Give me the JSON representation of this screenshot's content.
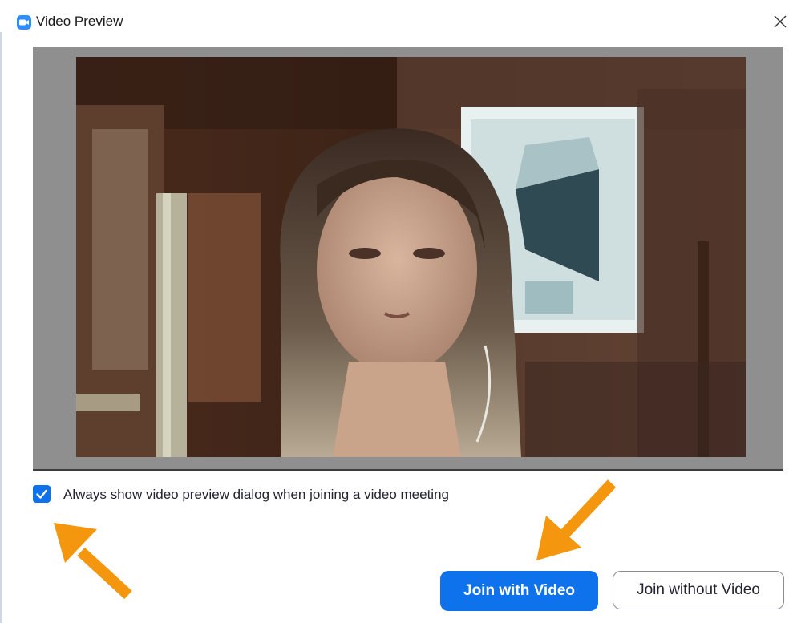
{
  "window": {
    "title": "Video Preview",
    "app_icon": "zoom-camera-icon",
    "close_icon": "close-icon"
  },
  "preview": {
    "content": "webcam-video-feed"
  },
  "options": {
    "always_show_preview": {
      "label": "Always show video preview dialog when joining a video meeting",
      "checked": true
    }
  },
  "buttons": {
    "join_with_video": "Join with Video",
    "join_without_video": "Join without Video"
  },
  "annotations": {
    "arrow_color": "#f5960f"
  },
  "colors": {
    "accent": "#0e72ed",
    "preview_background": "#8f8f8f"
  }
}
